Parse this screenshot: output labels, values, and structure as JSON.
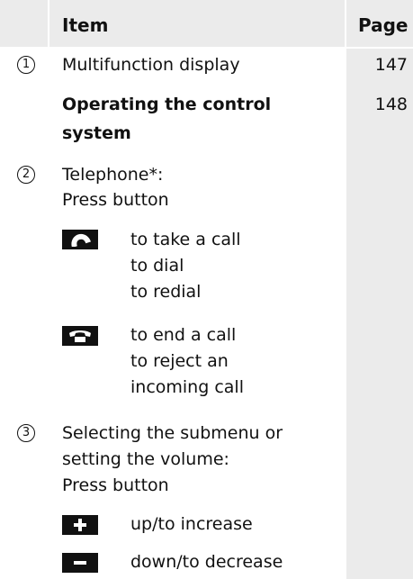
{
  "header": {
    "item": "Item",
    "page": "Page"
  },
  "rows": [
    {
      "num": "1",
      "text": "Multifunction display",
      "page": "147"
    },
    {
      "text_line1": "Operating the control",
      "text_line2": "system",
      "page": "148"
    },
    {
      "num": "2",
      "text_line1": "Telephone*:",
      "text_line2": "Press button"
    },
    {
      "key_icon": "phone-pickup-icon",
      "lines": [
        "to take a call",
        "to dial",
        "to redial"
      ]
    },
    {
      "key_icon": "phone-hangup-icon",
      "lines": [
        "to end a call",
        "to reject an",
        "incoming call"
      ]
    },
    {
      "num": "3",
      "lines": [
        "Selecting the submenu or",
        "setting the volume:",
        "Press button"
      ]
    },
    {
      "key_icon": "plus-icon",
      "text": "up/to increase"
    },
    {
      "key_icon": "minus-icon",
      "text": "down/to decrease"
    }
  ],
  "colors": {
    "cell": "#ebebeb",
    "key": "#111111"
  }
}
